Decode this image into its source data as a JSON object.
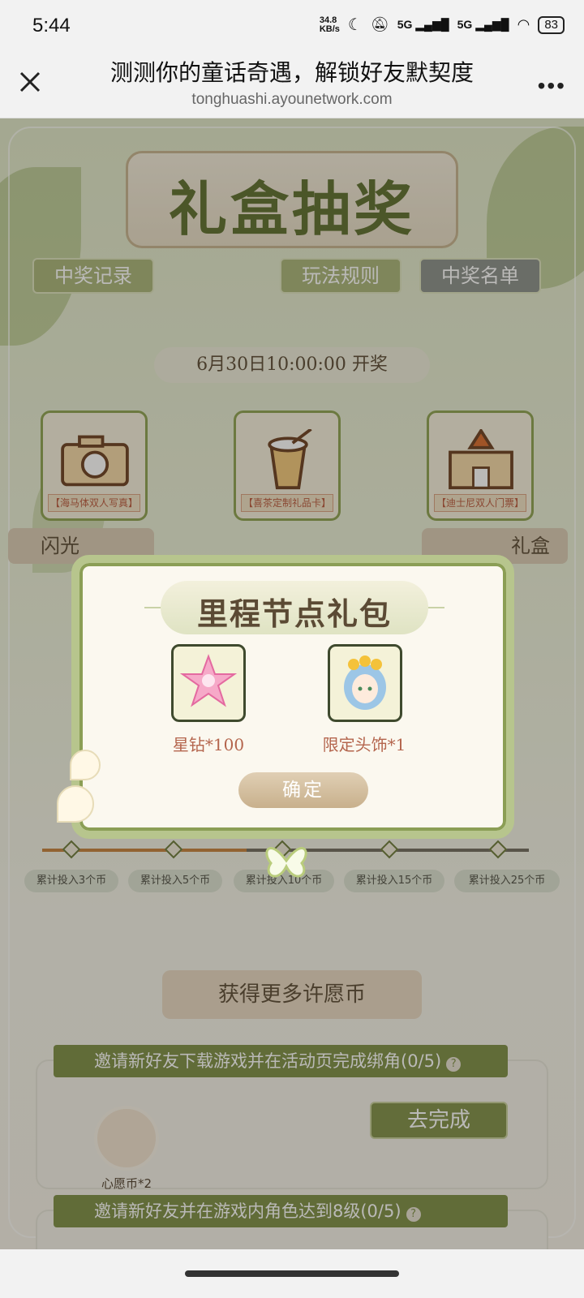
{
  "status_bar": {
    "time": "5:44",
    "speed": "34.8\nKB/s",
    "net1": "5G",
    "net2": "5G",
    "battery": "83"
  },
  "title_bar": {
    "title": "测测你的童话奇遇，解锁好友默契度",
    "url": "tonghuashi.ayounetwork.com",
    "more": "•••"
  },
  "page": {
    "banner_title": "礼盒抽奖",
    "buttons": {
      "records": "中奖记录",
      "rules": "玩法规则",
      "winners": "中奖名单"
    },
    "draw_time": "6月30日10:00:00 开奖",
    "prizes": [
      {
        "caption": "【海马体双人写真】"
      },
      {
        "caption": "【喜茶定制礼品卡】"
      },
      {
        "caption": "【迪士尼双人门票】"
      }
    ],
    "ribbons": [
      "闪光",
      "",
      "礼盒"
    ],
    "milestones": [
      "累计投入3个币",
      "累计投入5个币",
      "累计投入10个币",
      "累计投入15个币",
      "累计投入25个币"
    ],
    "progress_fraction": 0.42,
    "more_coins_title": "获得更多许愿币",
    "tasks": [
      {
        "title": "邀请新好友下载游戏并在活动页完成绑角(0/5)",
        "reward": "心愿币*2",
        "action": "去完成"
      },
      {
        "title": "邀请新好友并在游戏内角色达到8级(0/5)",
        "reward": "",
        "action": ""
      }
    ]
  },
  "modal": {
    "title": "里程节点礼包",
    "rewards": [
      {
        "label": "星钻*100",
        "icon": "star-diamond-icon"
      },
      {
        "label": "限定头饰*1",
        "icon": "avatar-headwear-icon"
      }
    ],
    "confirm": "确定"
  },
  "colors": {
    "accent_green": "#7c8e45",
    "text_brown": "#5b4a34",
    "reward_label": "#b4654d"
  }
}
